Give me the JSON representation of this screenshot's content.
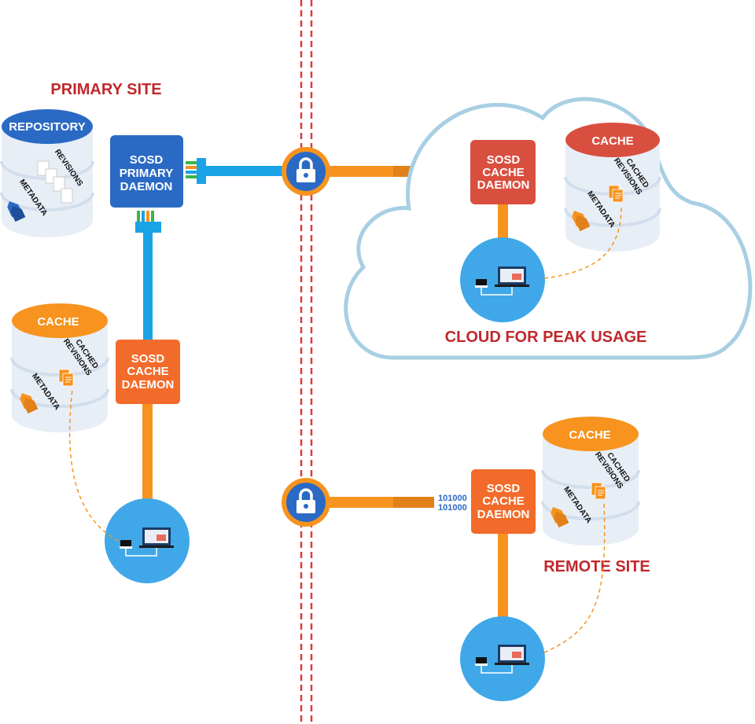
{
  "labels": {
    "primary_site": "PRIMARY SITE",
    "cloud": "CLOUD FOR PEAK USAGE",
    "remote_site": "REMOTE SITE"
  },
  "repository": {
    "title": "REPOSITORY",
    "revisions": "REVISIONS",
    "metadata": "METADATA"
  },
  "primary_daemon": {
    "line1": "SOSD",
    "line2": "PRIMARY",
    "line3": "DAEMON"
  },
  "cache_daemon": {
    "line1": "SOSD",
    "line2": "CACHE",
    "line3": "DAEMON"
  },
  "cache": {
    "title": "CACHE",
    "cached1": "CACHED",
    "cached2": "REVISIONS",
    "metadata": "METADATA"
  },
  "binary": "101000",
  "colors": {
    "blue": "#2a6ac4",
    "light_blue": "#1aa3e6",
    "client_blue": "#40a8e8",
    "orange": "#f7931e",
    "deep_orange": "#f26b2a",
    "red": "#d94f3f",
    "site_red": "#c0282d",
    "cloud_outline": "#a8cfe3",
    "divider": "#e03a3a"
  },
  "icons": [
    "lock-icon",
    "laptop-icon",
    "router-icon",
    "document-icon",
    "tag-icon",
    "database-icon",
    "cloud-icon"
  ]
}
